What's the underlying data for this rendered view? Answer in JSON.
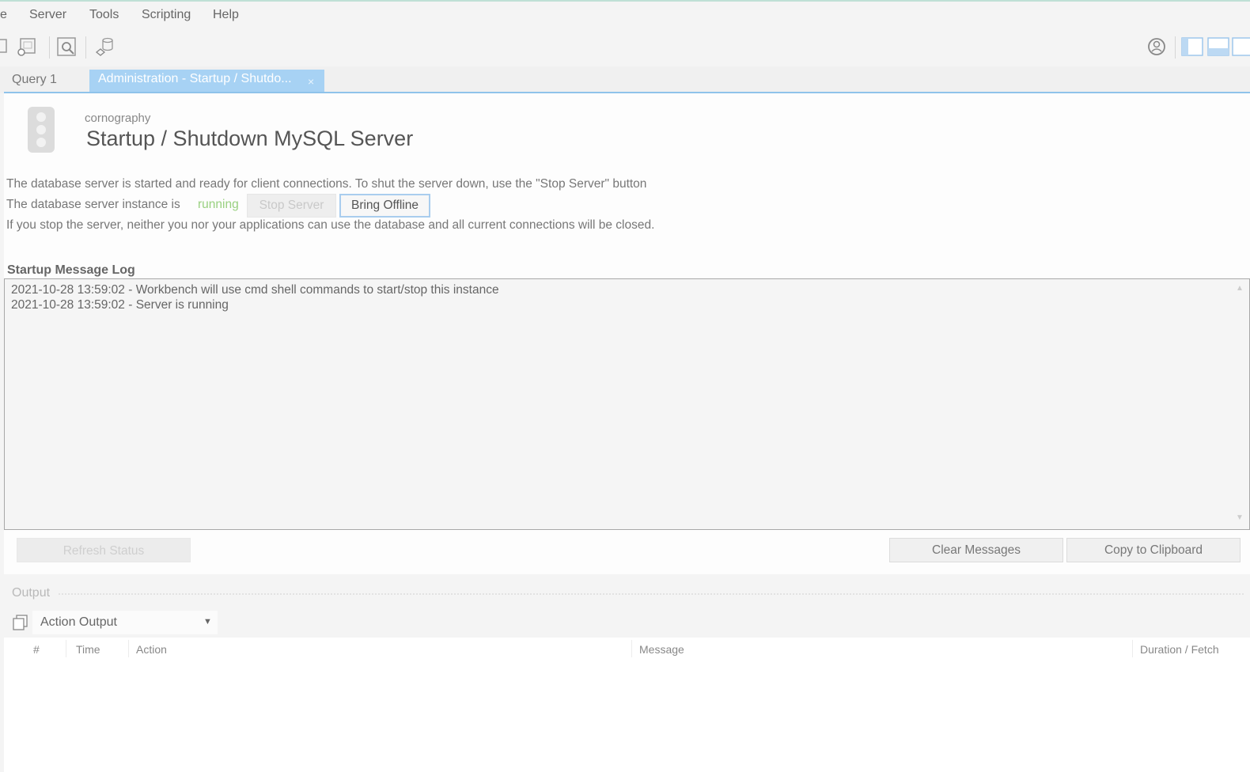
{
  "menu": [
    "e",
    "Server",
    "Tools",
    "Scripting",
    "Help"
  ],
  "toolbar": {
    "left_icons": [
      "new-sql-tab-icon",
      "open-sql-script-icon",
      "inspector-icon",
      "database-connect-icon"
    ],
    "right_icons": [
      "user-profile-icon",
      "toggle-sidebar-icon",
      "toggle-output-panel-icon",
      "toggle-secondary-sidebar-icon"
    ]
  },
  "tabs": [
    {
      "label": "Query 1",
      "active": false
    },
    {
      "label": "Administration - Startup / Shutdo...",
      "active": true,
      "close": "×"
    }
  ],
  "header": {
    "subtitle": "cornography",
    "title": "Startup / Shutdown MySQL Server",
    "icon": "traffic-light-icon"
  },
  "status": {
    "line1": "The database server is started and ready for client connections. To shut the server down, use the \"Stop Server\" button",
    "line2_prefix": "The database server instance is",
    "state": "running",
    "state_color": "#98d07f",
    "line3": "If you stop the server, neither you nor your applications can use the database and all current connections will be closed.",
    "stop_button": "Stop Server",
    "offline_button": "Bring Offline"
  },
  "log": {
    "label": "Startup Message Log",
    "lines": [
      "2021-10-28 13:59:02 - Workbench will use cmd shell commands to start/stop this instance",
      "2021-10-28 13:59:02 - Server is running"
    ]
  },
  "actions": {
    "refresh": "Refresh Status",
    "clear": "Clear Messages",
    "copy": "Copy to Clipboard"
  },
  "output": {
    "title": "Output",
    "selector": "Action Output",
    "columns": [
      "#",
      "Time",
      "Action",
      "Message",
      "Duration / Fetch"
    ]
  },
  "colors": {
    "active_tab": "#a7d2f4",
    "tab_underline": "#8fc3ea",
    "running": "#98d07f"
  }
}
